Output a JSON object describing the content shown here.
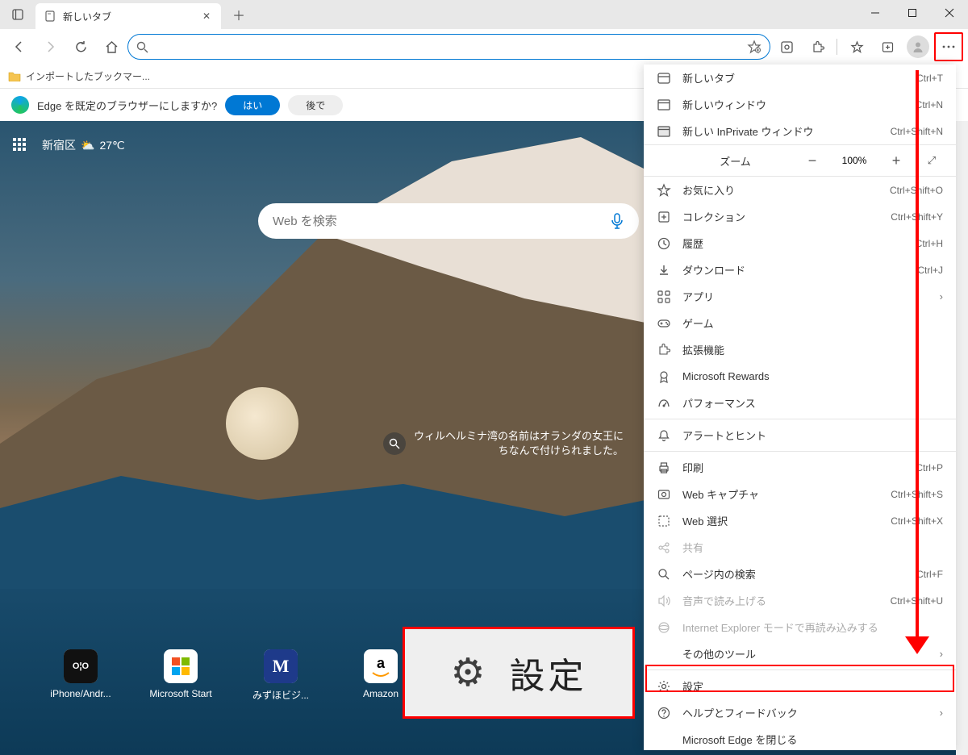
{
  "window": {
    "tab_title": "新しいタブ"
  },
  "toolbar": {
    "address_value": ""
  },
  "bookmarks": {
    "folder": "インポートしたブックマー..."
  },
  "prompt": {
    "text": "Edge を既定のブラウザーにしますか?",
    "yes": "はい",
    "later": "後で"
  },
  "ntp": {
    "location": "新宿区",
    "temp": "27℃",
    "search_placeholder": "Web を検索",
    "info": "ウィルヘルミナ湾の名前はオランダの女王にちなんで付けられました。",
    "quicklinks": [
      {
        "label": "iPhone/Andr..."
      },
      {
        "label": "Microsoft Start"
      },
      {
        "label": "みずほビジ..."
      },
      {
        "label": "Amazon"
      }
    ]
  },
  "callout": {
    "label": "設定"
  },
  "menu": {
    "items": [
      {
        "icon": "tab",
        "label": "新しいタブ",
        "short": "Ctrl+T"
      },
      {
        "icon": "window",
        "label": "新しいウィンドウ",
        "short": "Ctrl+N"
      },
      {
        "icon": "inprivate",
        "label": "新しい InPrivate ウィンドウ",
        "short": "Ctrl+Shift+N"
      },
      {
        "type": "zoom",
        "label": "ズーム",
        "pct": "100%"
      },
      {
        "icon": "star",
        "label": "お気に入り",
        "short": "Ctrl+Shift+O"
      },
      {
        "icon": "collection",
        "label": "コレクション",
        "short": "Ctrl+Shift+Y"
      },
      {
        "icon": "history",
        "label": "履歴",
        "short": "Ctrl+H"
      },
      {
        "icon": "download",
        "label": "ダウンロード",
        "short": "Ctrl+J"
      },
      {
        "icon": "apps",
        "label": "アプリ",
        "arrow": true
      },
      {
        "icon": "games",
        "label": "ゲーム"
      },
      {
        "icon": "ext",
        "label": "拡張機能"
      },
      {
        "icon": "rewards",
        "label": "Microsoft Rewards"
      },
      {
        "icon": "perf",
        "label": "パフォーマンス"
      },
      {
        "type": "div"
      },
      {
        "icon": "bell",
        "label": "アラートとヒント"
      },
      {
        "type": "div"
      },
      {
        "icon": "print",
        "label": "印刷",
        "short": "Ctrl+P"
      },
      {
        "icon": "capture",
        "label": "Web キャプチャ",
        "short": "Ctrl+Shift+S"
      },
      {
        "icon": "select",
        "label": "Web 選択",
        "short": "Ctrl+Shift+X"
      },
      {
        "icon": "share",
        "label": "共有",
        "disabled": true
      },
      {
        "icon": "find",
        "label": "ページ内の検索",
        "short": "Ctrl+F"
      },
      {
        "icon": "read",
        "label": "音声で読み上げる",
        "short": "Ctrl+Shift+U",
        "disabled": true
      },
      {
        "icon": "ie",
        "label": "Internet Explorer モードで再読み込みする",
        "disabled": true
      },
      {
        "label": "その他のツール",
        "arrow": true,
        "noicon": true
      },
      {
        "type": "div"
      },
      {
        "icon": "gear",
        "label": "設定"
      },
      {
        "icon": "help",
        "label": "ヘルプとフィードバック",
        "arrow": true
      },
      {
        "label": "Microsoft Edge を閉じる",
        "noicon": true
      }
    ]
  }
}
